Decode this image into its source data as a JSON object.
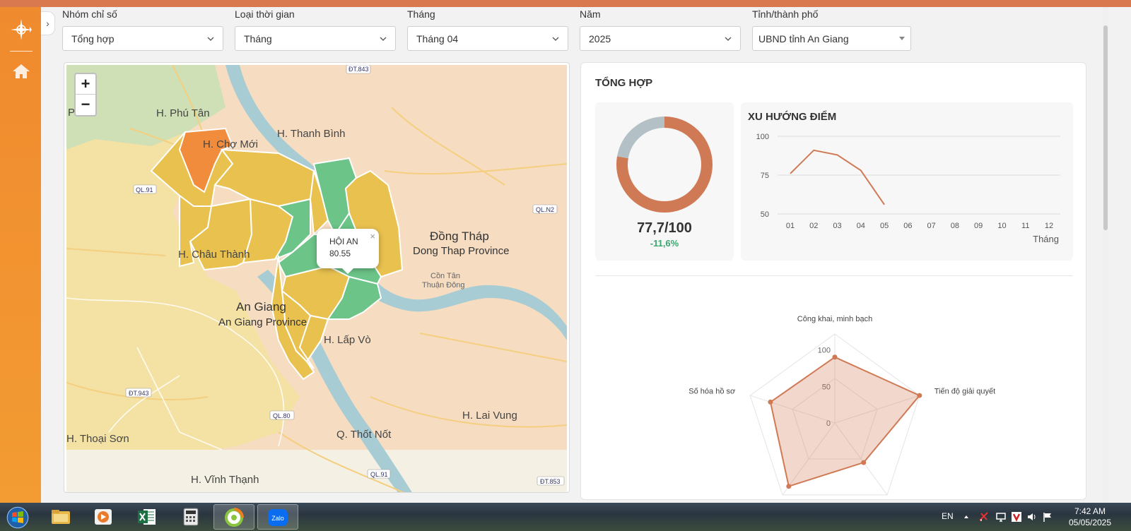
{
  "filters": [
    {
      "label": "Nhóm chỉ số",
      "value": "Tổng hợp"
    },
    {
      "label": "Loại thời gian",
      "value": "Tháng"
    },
    {
      "label": "Tháng",
      "value": "Tháng 04"
    },
    {
      "label": "Năm",
      "value": "2025"
    },
    {
      "label": "Tỉnh/thành phố",
      "value": "UBND tỉnh An Giang"
    }
  ],
  "sidebar": {
    "logo_icon": "compass-logo-icon",
    "home_icon": "home-icon",
    "collapse_icon": "chevron-right-icon"
  },
  "map": {
    "zoom_in": "+",
    "zoom_out": "−",
    "popup": {
      "name": "HỘI AN",
      "value": "80.55",
      "close": "×"
    },
    "place_labels": [
      "H. Phú Tân",
      "H. Chợ Mới",
      "H. Thanh Bình",
      "Đồng Tháp",
      "Dong Thap Province",
      "H. Châu Thành",
      "An Giang",
      "An Giang Province",
      "Cồn Tân",
      "Thuận Đông",
      "H. Lấp Vò",
      "H. Lai Vung",
      "Q. Thốt Nốt",
      "H. Vĩnh Thạnh",
      "H. Thoại Sơn",
      "Phú"
    ],
    "road_labels": [
      "ĐT.843",
      "QL.91",
      "QL.N2",
      "ĐT.943",
      "QL.80",
      "QL.91",
      "ĐT.853"
    ],
    "colors": {
      "high": "#6cc488",
      "mid": "#e8c14f",
      "low": "#f08c3c",
      "land": "#f6dcc0",
      "river": "#a8ccd4"
    }
  },
  "summary": {
    "title": "TỔNG HỢP",
    "score": "77,7/100",
    "delta": "-11,6%",
    "donut": {
      "value": 77.7,
      "max": 100,
      "colors": {
        "value": "#d07a55",
        "rest": "#b3c1c6"
      }
    }
  },
  "trend": {
    "title": "XU HƯỚNG ĐIỂM",
    "x_label": "Tháng",
    "y_ticks": [
      "100",
      "75",
      "50"
    ]
  },
  "radar": {
    "axes": [
      "Công khai, minh bạch",
      "Tiến độ giải quyết",
      "",
      "",
      "Số hóa hồ sơ"
    ],
    "ticks": [
      "100",
      "50",
      "0"
    ]
  },
  "chart_data": [
    {
      "type": "line",
      "title": "XU HƯỚNG ĐIỂM",
      "xlabel": "Tháng",
      "ylabel": "",
      "x": [
        "01",
        "02",
        "03",
        "04",
        "05",
        "06",
        "07",
        "08",
        "09",
        "10",
        "11",
        "12"
      ],
      "series": [
        {
          "values": [
            76,
            91,
            88,
            78,
            56,
            null,
            null,
            null,
            null,
            null,
            null,
            null
          ],
          "color": "#d07a55"
        }
      ],
      "ylim": [
        50,
        100
      ],
      "grid": true
    },
    {
      "type": "pie",
      "title": "",
      "values": [
        77.7,
        22.3
      ],
      "colors": [
        "#d07a55",
        "#b3c1c6"
      ]
    },
    {
      "type": "radar",
      "title": "",
      "axes": [
        "Công khai, minh bạch",
        "Tiến độ giải quyết",
        "",
        "",
        "Số hóa hồ sơ"
      ],
      "values": [
        74,
        100,
        55,
        88,
        76
      ],
      "range": [
        0,
        100
      ],
      "color": "#d07a55"
    }
  ],
  "taskbar": {
    "start_icon": "windows-start-icon",
    "apps": [
      "file-explorer-icon",
      "media-player-icon",
      "excel-icon",
      "calculator-icon",
      "coccoc-browser-icon",
      "zalo-icon"
    ],
    "zalo_label": "Zalo",
    "lang": "EN",
    "time": "7:42 AM",
    "date": "05/05/2025"
  }
}
